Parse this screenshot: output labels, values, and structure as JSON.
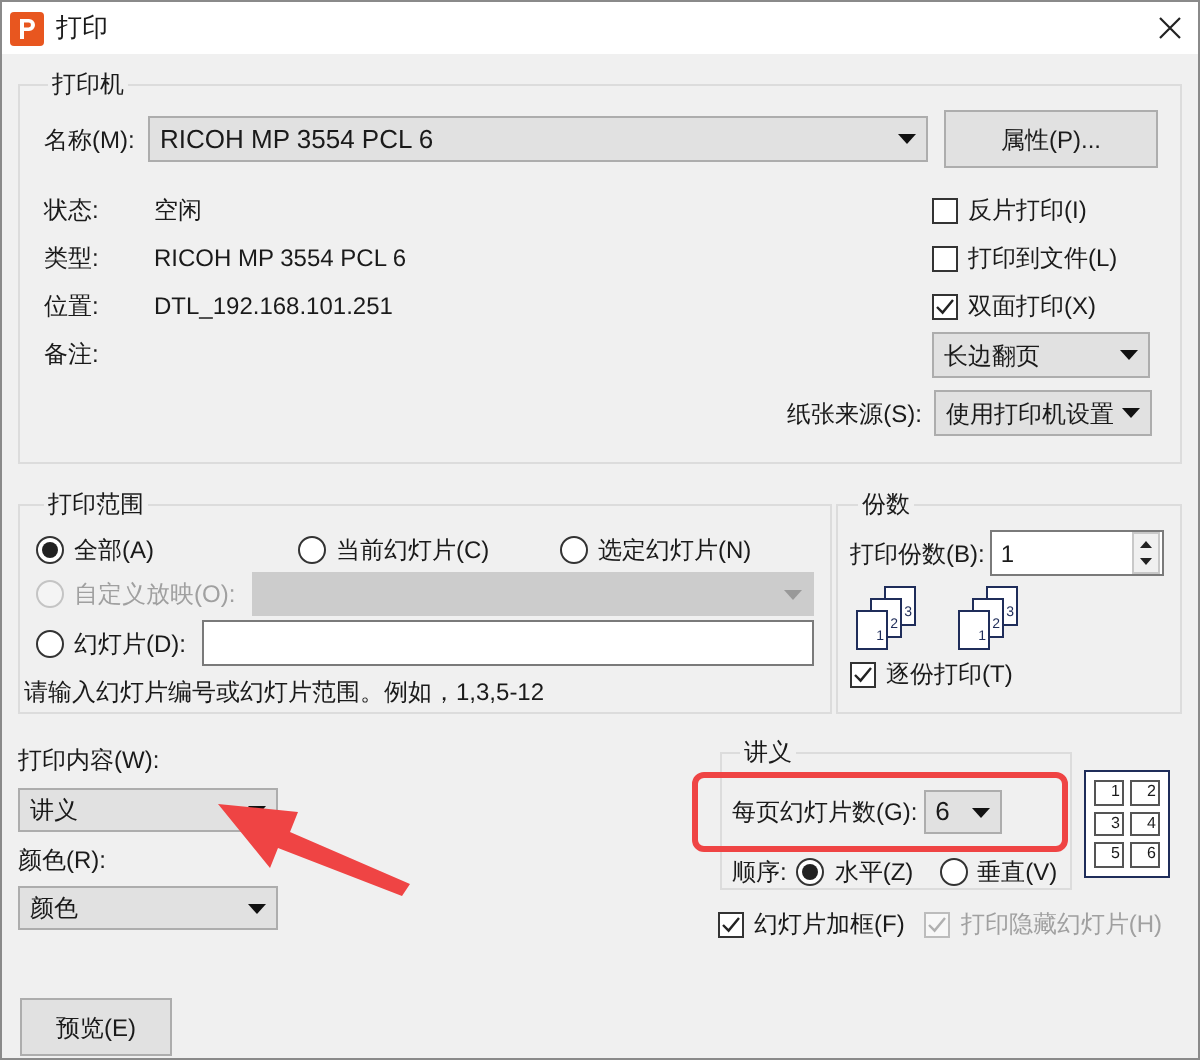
{
  "window": {
    "title": "打印"
  },
  "printer": {
    "group_title": "打印机",
    "name_label": "名称(M):",
    "name_value": "RICOH MP 3554 PCL 6",
    "properties_button": "属性(P)...",
    "info": [
      {
        "label": "状态:",
        "value": "空闲"
      },
      {
        "label": "类型:",
        "value": "RICOH MP 3554 PCL 6"
      },
      {
        "label": "位置:",
        "value": "DTL_192.168.101.251"
      },
      {
        "label": "备注:"
      }
    ],
    "options": [
      {
        "label": "反片打印(I)",
        "checked": false
      },
      {
        "label": "打印到文件(L)",
        "checked": false
      },
      {
        "label": "双面打印(X)",
        "checked": true
      }
    ],
    "duplex_mode": "长边翻页",
    "paper_source_label": "纸张来源(S):",
    "paper_source": "使用打印机设置"
  },
  "print_range": {
    "group_title": "打印范围",
    "choices": [
      {
        "label": "全部(A)",
        "selected": true,
        "disabled": false
      },
      {
        "label": "当前幻灯片(C)",
        "selected": false,
        "disabled": false
      },
      {
        "label": "选定幻灯片(N)",
        "selected": false,
        "disabled": false
      },
      {
        "label": "自定义放映(O):",
        "selected": false,
        "disabled": true
      },
      {
        "label": "幻灯片(D):",
        "selected": false,
        "disabled": false
      }
    ],
    "hint": "请输入幻灯片编号或幻灯片范围。例如，1,3,5-12"
  },
  "copies": {
    "group_title": "份数",
    "count_label": "打印份数(B):",
    "count": "1",
    "stacks": [
      [
        "1",
        "2",
        "3"
      ],
      [
        "1",
        "2",
        "3"
      ]
    ],
    "collate": {
      "label": "逐份打印(T)",
      "checked": true
    }
  },
  "print_content": {
    "label": "打印内容(W):",
    "value": "讲义"
  },
  "color": {
    "label": "颜色(R):",
    "value": "颜色"
  },
  "preview_button": "预览(E)",
  "handouts": {
    "group_title": "讲义",
    "per_page_label": "每页幻灯片数(G):",
    "per_page": "6",
    "order_label": "顺序:",
    "order": [
      {
        "label": "水平(Z)",
        "selected": true
      },
      {
        "label": "垂直(V)",
        "selected": false
      }
    ],
    "layout_numbers": [
      "1",
      "2",
      "3",
      "4",
      "5",
      "6"
    ]
  },
  "bottom_options": [
    {
      "label": "幻灯片加框(F)",
      "checked": true,
      "disabled": false
    },
    {
      "label": "打印隐藏幻灯片(H)",
      "checked": true,
      "disabled": true
    }
  ]
}
